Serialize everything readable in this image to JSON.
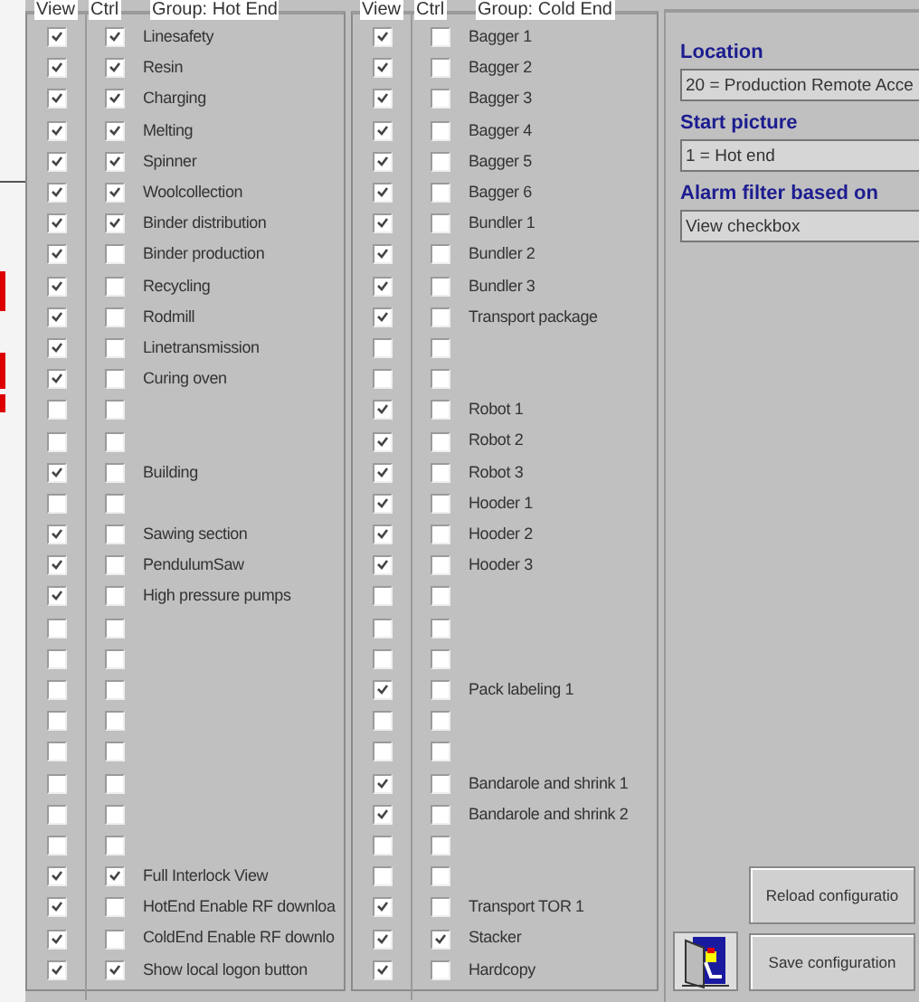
{
  "groups": [
    {
      "view_header": "View",
      "ctrl_header": "Ctrl",
      "title": "Group: Hot End",
      "rows": [
        {
          "label": "Linesafety",
          "view": true,
          "ctrl": true
        },
        {
          "label": "Resin",
          "view": true,
          "ctrl": true
        },
        {
          "label": "Charging",
          "view": true,
          "ctrl": true
        },
        {
          "label": "Melting",
          "view": true,
          "ctrl": true
        },
        {
          "label": "Spinner",
          "view": true,
          "ctrl": true
        },
        {
          "label": "Woolcollection",
          "view": true,
          "ctrl": true
        },
        {
          "label": "Binder distribution",
          "view": true,
          "ctrl": true
        },
        {
          "label": "Binder production",
          "view": true,
          "ctrl": false
        },
        {
          "label": "Recycling",
          "view": true,
          "ctrl": false
        },
        {
          "label": "Rodmill",
          "view": true,
          "ctrl": false
        },
        {
          "label": "Linetransmission",
          "view": true,
          "ctrl": false
        },
        {
          "label": "Curing oven",
          "view": true,
          "ctrl": false
        },
        {
          "view": false,
          "ctrl": false
        },
        {
          "view": false,
          "ctrl": false
        },
        {
          "label": "Building",
          "view": true,
          "ctrl": false
        },
        {
          "view": false,
          "ctrl": false
        },
        {
          "label": "Sawing section",
          "view": true,
          "ctrl": false
        },
        {
          "label": "PendulumSaw",
          "view": true,
          "ctrl": false
        },
        {
          "label": "High pressure pumps",
          "view": true,
          "ctrl": false
        },
        {
          "view": false,
          "ctrl": false
        },
        {
          "view": false,
          "ctrl": false
        },
        {
          "view": false,
          "ctrl": false
        },
        {
          "view": false,
          "ctrl": false
        },
        {
          "view": false,
          "ctrl": false
        },
        {
          "view": false,
          "ctrl": false
        },
        {
          "view": false,
          "ctrl": false
        },
        {
          "view": false,
          "ctrl": false
        },
        {
          "label": "Full Interlock View",
          "view": true,
          "ctrl": true
        },
        {
          "label": "HotEnd Enable RF downloa",
          "view": true,
          "ctrl": false
        },
        {
          "label": "ColdEnd Enable RF downlo",
          "view": true,
          "ctrl": false
        },
        {
          "label": "Show local logon button",
          "view": true,
          "ctrl": true
        }
      ]
    },
    {
      "view_header": "View",
      "ctrl_header": "Ctrl",
      "title": "Group: Cold End",
      "rows": [
        {
          "label": "Bagger 1",
          "view": true,
          "ctrl": false
        },
        {
          "label": "Bagger 2",
          "view": true,
          "ctrl": false
        },
        {
          "label": "Bagger 3",
          "view": true,
          "ctrl": false
        },
        {
          "label": "Bagger 4",
          "view": true,
          "ctrl": false
        },
        {
          "label": "Bagger 5",
          "view": true,
          "ctrl": false
        },
        {
          "label": "Bagger 6",
          "view": true,
          "ctrl": false
        },
        {
          "label": "Bundler 1",
          "view": true,
          "ctrl": false
        },
        {
          "label": "Bundler 2",
          "view": true,
          "ctrl": false
        },
        {
          "label": "Bundler 3",
          "view": true,
          "ctrl": false
        },
        {
          "label": "Transport package",
          "view": true,
          "ctrl": false
        },
        {
          "view": false,
          "ctrl": false
        },
        {
          "view": false,
          "ctrl": false
        },
        {
          "label": "Robot 1",
          "view": true,
          "ctrl": false
        },
        {
          "label": "Robot 2",
          "view": true,
          "ctrl": false
        },
        {
          "label": "Robot 3",
          "view": true,
          "ctrl": false
        },
        {
          "label": "Hooder 1",
          "view": true,
          "ctrl": false
        },
        {
          "label": "Hooder 2",
          "view": true,
          "ctrl": false
        },
        {
          "label": "Hooder 3",
          "view": true,
          "ctrl": false
        },
        {
          "view": false,
          "ctrl": false
        },
        {
          "view": false,
          "ctrl": false
        },
        {
          "view": false,
          "ctrl": false
        },
        {
          "label": "Pack labeling 1",
          "view": true,
          "ctrl": false
        },
        {
          "view": false,
          "ctrl": false
        },
        {
          "view": false,
          "ctrl": false
        },
        {
          "label": "Bandarole and shrink 1",
          "view": true,
          "ctrl": false
        },
        {
          "label": "Bandarole and shrink 2",
          "view": true,
          "ctrl": false
        },
        {
          "view": false,
          "ctrl": false
        },
        {
          "view": false,
          "ctrl": false
        },
        {
          "label": "Transport TOR 1",
          "view": true,
          "ctrl": false
        },
        {
          "label": "Stacker",
          "view": true,
          "ctrl": true
        },
        {
          "label": "Hardcopy",
          "view": true,
          "ctrl": false
        }
      ]
    }
  ],
  "settings": [
    {
      "label": "Location",
      "value": "20 = Production Remote Acce"
    },
    {
      "label": "Start picture",
      "value": "1 = Hot end"
    },
    {
      "label": "Alarm filter based on",
      "value": "View checkbox"
    }
  ],
  "buttons": [
    "Reload configuratio",
    "Save configuration"
  ]
}
